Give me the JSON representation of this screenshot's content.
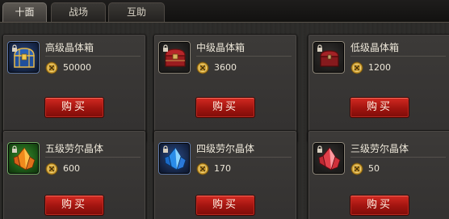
{
  "tabs": [
    {
      "label": "十面",
      "active": true
    },
    {
      "label": "战场",
      "active": false
    },
    {
      "label": "互助",
      "active": false
    }
  ],
  "currency_icon": "gold-coin-icon",
  "lock_icon": "lock-icon",
  "items": [
    {
      "name": "高级晶体箱",
      "price": "50000",
      "icon": "chest-blue-gold-icon",
      "button": "购买"
    },
    {
      "name": "中级晶体箱",
      "price": "3600",
      "icon": "chest-red-icon",
      "button": "购买"
    },
    {
      "name": "低级晶体箱",
      "price": "1200",
      "icon": "chest-red-small-icon",
      "button": "购买"
    },
    {
      "name": "五级劳尔晶体",
      "price": "600",
      "icon": "crystal-orange-icon",
      "button": "购买"
    },
    {
      "name": "四级劳尔晶体",
      "price": "170",
      "icon": "crystal-blue-icon",
      "button": "购买"
    },
    {
      "name": "三级劳尔晶体",
      "price": "50",
      "icon": "crystal-red-icon",
      "button": "购买"
    }
  ]
}
